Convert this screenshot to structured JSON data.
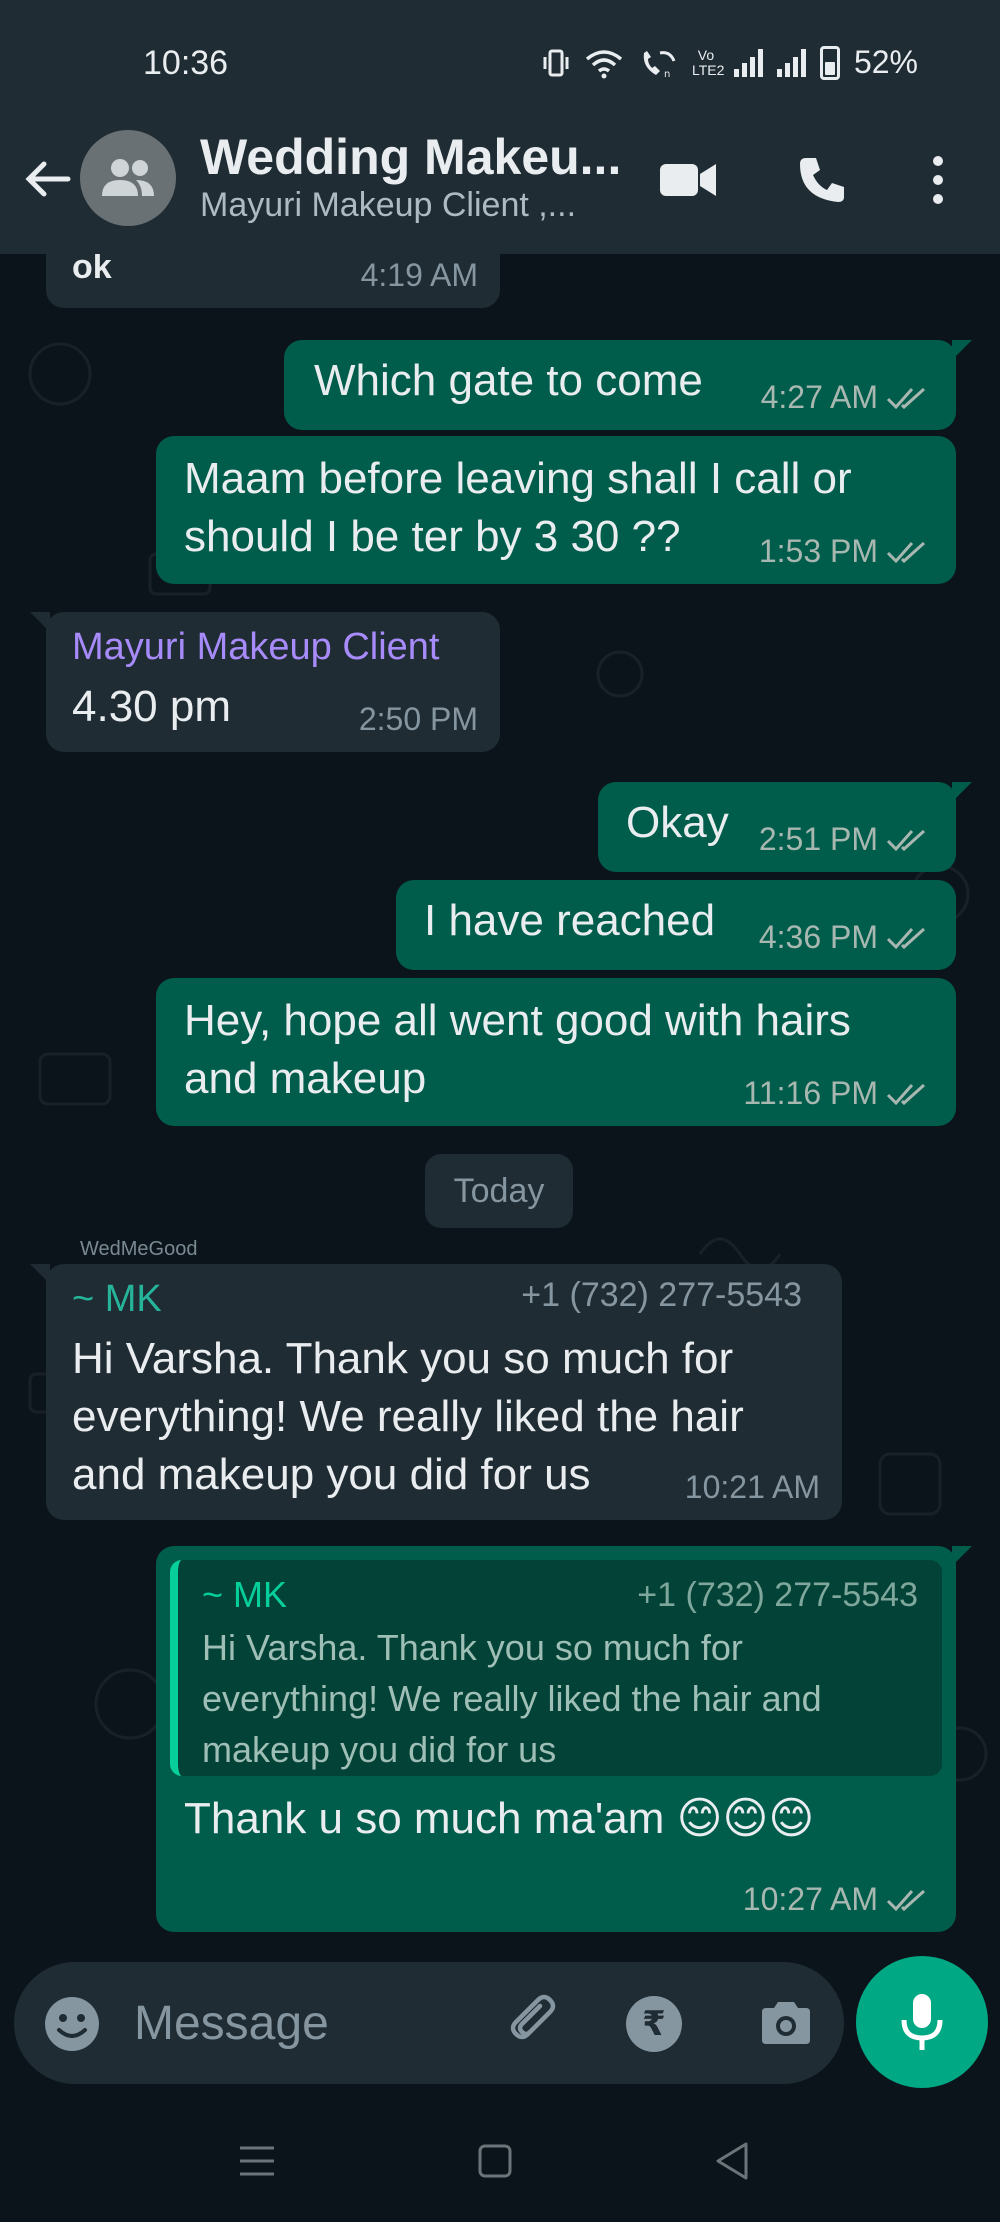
{
  "status_bar": {
    "time": "10:36",
    "battery": "52%",
    "volte_label": "Vo LTE2"
  },
  "header": {
    "title": "Wedding Makeu...",
    "subtitle": "Mayuri Makeup Client ,..."
  },
  "messages": [
    {
      "id": "m0",
      "direction": "in",
      "text": "ok",
      "time": "4:19 AM"
    },
    {
      "id": "m1",
      "direction": "out",
      "text": "Which gate to come",
      "time": "4:27 AM"
    },
    {
      "id": "m2",
      "direction": "out",
      "lines": [
        "Maam before leaving shall I call or",
        "should I be ter by 3 30 ??"
      ],
      "time": "1:53 PM"
    },
    {
      "id": "m3",
      "direction": "in",
      "sender": "Mayuri Makeup Client",
      "text": "4.30 pm",
      "time": "2:50 PM"
    },
    {
      "id": "m4",
      "direction": "out",
      "text": "Okay",
      "time": "2:51 PM"
    },
    {
      "id": "m5",
      "direction": "out",
      "text": "I have reached",
      "time": "4:36 PM"
    },
    {
      "id": "m6",
      "direction": "out",
      "lines": [
        "Hey, hope all went good with hairs",
        "and makeup"
      ],
      "time": "11:16 PM"
    },
    {
      "id": "m7",
      "direction": "in",
      "sender": "~ MK",
      "phone": "+1 (732) 277-5543",
      "lines": [
        "Hi Varsha. Thank you so much for",
        "everything! We really liked the hair",
        "and makeup you did for us"
      ],
      "time": "10:21 AM"
    },
    {
      "id": "m8",
      "direction": "out",
      "text": "Thank u so much ma'am 😊😊😊",
      "time": "10:27 AM",
      "quote": {
        "sender": "~ MK",
        "phone": "+1 (732) 277-5543",
        "lines": [
          "Hi Varsha. Thank you so much for",
          "everything! We really liked the hair and",
          "makeup you did for us"
        ]
      }
    }
  ],
  "date_chip": "Today",
  "watermark": "WedMeGood",
  "composer": {
    "placeholder": "Message",
    "rupee": "₹"
  },
  "colors": {
    "accent": "#00a884",
    "outgoing_bubble": "#005c4b",
    "incoming_bubble": "#202c33",
    "header": "#1f2c34"
  }
}
